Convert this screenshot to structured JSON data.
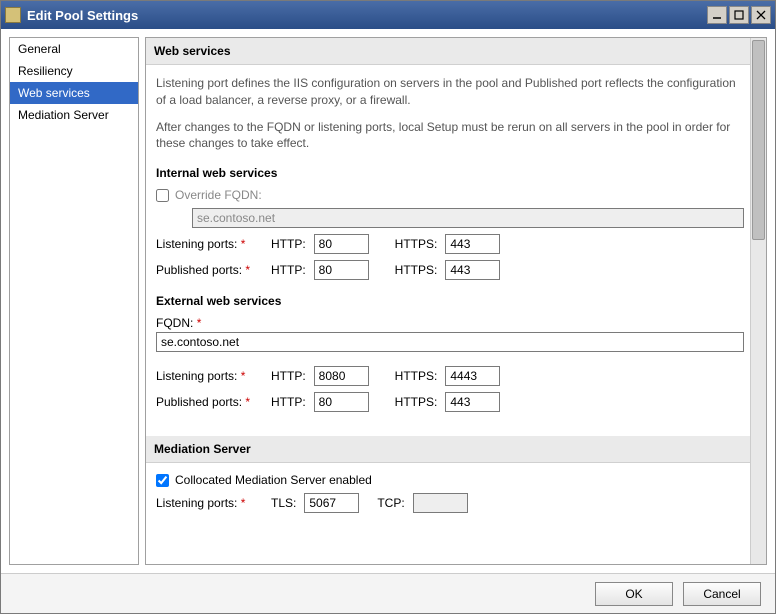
{
  "window": {
    "title": "Edit Pool Settings"
  },
  "sidebar": {
    "items": [
      {
        "label": "General"
      },
      {
        "label": "Resiliency"
      },
      {
        "label": "Web services"
      },
      {
        "label": "Mediation Server"
      }
    ]
  },
  "webServices": {
    "header": "Web services",
    "desc1": "Listening port defines the IIS configuration on servers in the pool and Published port reflects the configuration of a load balancer, a reverse proxy, or a firewall.",
    "desc2": "After changes to the FQDN or listening ports, local Setup must be rerun on all servers in the pool in order for these changes to take effect.",
    "internal": {
      "header": "Internal web services",
      "overrideLabel": "Override FQDN:",
      "overrideChecked": false,
      "fqdn": "se.contoso.net",
      "listeningLabel": "Listening ports:",
      "publishedLabel": "Published ports:",
      "httpLabel": "HTTP:",
      "httpsLabel": "HTTPS:",
      "listenHttp": "80",
      "listenHttps": "443",
      "pubHttp": "80",
      "pubHttps": "443"
    },
    "external": {
      "header": "External web services",
      "fqdnLabel": "FQDN:",
      "fqdn": "se.contoso.net",
      "listeningLabel": "Listening ports:",
      "publishedLabel": "Published ports:",
      "httpLabel": "HTTP:",
      "httpsLabel": "HTTPS:",
      "listenHttp": "8080",
      "listenHttps": "4443",
      "pubHttp": "80",
      "pubHttps": "443"
    }
  },
  "mediation": {
    "header": "Mediation Server",
    "collocatedLabel": "Collocated Mediation Server enabled",
    "collocatedChecked": true,
    "listeningLabel": "Listening ports:",
    "tlsLabel": "TLS:",
    "tcpLabel": "TCP:",
    "tls": "5067",
    "tcp": ""
  },
  "footer": {
    "ok": "OK",
    "cancel": "Cancel"
  }
}
